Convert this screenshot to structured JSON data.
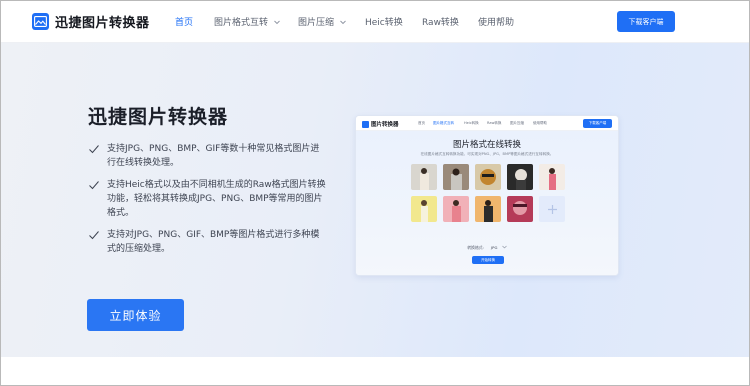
{
  "brand": {
    "name": "迅捷图片转换器",
    "accent": "#1f6ff5"
  },
  "nav": {
    "items": [
      {
        "label": "首页",
        "active": true,
        "dropdown": false
      },
      {
        "label": "图片格式互转",
        "active": false,
        "dropdown": true
      },
      {
        "label": "图片压缩",
        "active": false,
        "dropdown": true
      },
      {
        "label": "Heic转换",
        "active": false,
        "dropdown": false
      },
      {
        "label": "Raw转换",
        "active": false,
        "dropdown": false
      },
      {
        "label": "使用帮助",
        "active": false,
        "dropdown": false
      }
    ],
    "cta": "下载客户端"
  },
  "hero": {
    "title": "迅捷图片转换器",
    "features": [
      "支持JPG、PNG、BMP、GIF等数十种常见格式图片进行在线转换处理。",
      "支持Heic格式以及由不同相机生成的Raw格式图片转换功能，轻松将其转换成JPG、PNG、BMP等常用的图片格式。",
      "支持对JPG、PNG、GIF、BMP等图片格式进行多种模式的压缩处理。"
    ],
    "cta": "立即体验"
  },
  "mock": {
    "brand": "图片转换器",
    "nav": [
      "首页",
      "图片格式互转",
      "Heic转换",
      "Raw转换",
      "图片压缩",
      "使用帮助"
    ],
    "cta": "下载客户端",
    "title": "图片格式在线转换",
    "subtitle": "在线图片格式互转转换功能，可实现对PNG、JPG、BMP等图片格式进行互转转换。",
    "format_label": "转换格式:",
    "format_value": "JPG",
    "convert_button": "开始转换"
  }
}
